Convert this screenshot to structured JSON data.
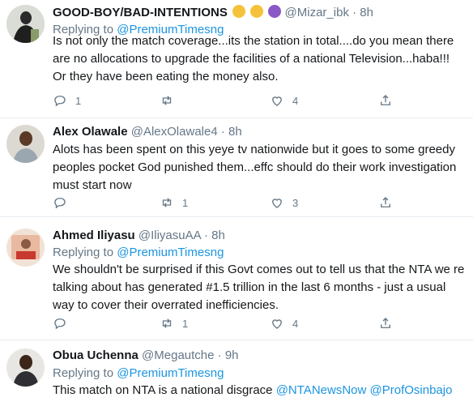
{
  "tweets": [
    {
      "name": "GOOD-BOY/BAD-INTENTIONS",
      "emojis": [
        "relieved-face-emoji",
        "winking-tongue-emoji",
        "purple-devil-emoji"
      ],
      "handle": "@Mizar_ibk",
      "dot": "·",
      "time": "8h",
      "replying_prefix": "Replying to",
      "replying_to": "@PremiumTimesng",
      "text": "Is not only the match coverage...its the station in total....do you mean there are no allocations to upgrade the facilities of a national Television...haba!!! Or they have been eating the money also.",
      "replies": "1",
      "retweets": "",
      "likes": "4"
    },
    {
      "name": "Alex Olawale",
      "handle": "@AlexOlawale4",
      "dot": "·",
      "time": "8h",
      "text": "Alots has been spent on this yeye tv nationwide but it goes to some greedy peoples pocket God punished them...effc should do their work investigation must start now",
      "replies": "",
      "retweets": "1",
      "likes": "3"
    },
    {
      "name": "Ahmed Iliyasu",
      "handle": "@IliyasuAA",
      "dot": "·",
      "time": "8h",
      "replying_prefix": "Replying to",
      "replying_to": "@PremiumTimesng",
      "text": "We shouldn't be surprised if this Govt comes out to tell us that the NTA we re talking about has generated #1.5 trillion in the last 6 months - just a usual way to cover their overrated  inefficiencies.",
      "replies": "",
      "retweets": "1",
      "likes": "4"
    },
    {
      "name": "Obua Uchenna",
      "handle": "@Megautche",
      "dot": "·",
      "time": "9h",
      "replying_prefix": "Replying to",
      "replying_to": "@PremiumTimesng",
      "text_plain": "This match on NTA is a national disgrace",
      "mention_1": "@NTANewsNow",
      "mention_2": "@ProfOsinbajo"
    }
  ],
  "colors": {
    "link": "#1b95e0",
    "muted": "#657786",
    "text": "#14171a",
    "divider": "#e6ecf0"
  },
  "icons": {
    "reply": "reply-icon",
    "retweet": "retweet-icon",
    "like": "heart-icon",
    "share": "share-icon"
  }
}
